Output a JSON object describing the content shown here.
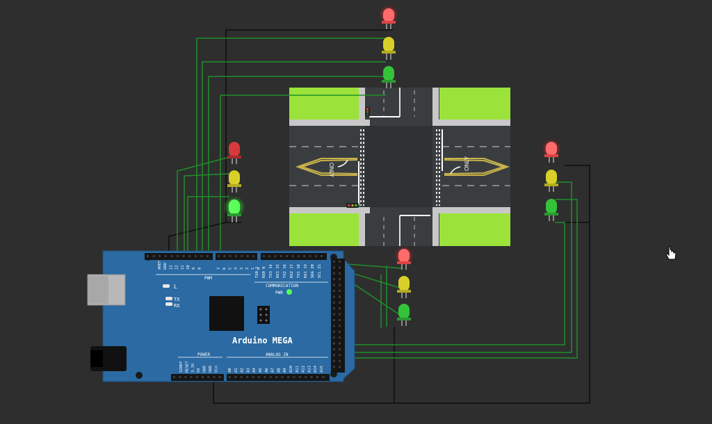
{
  "board": {
    "name": "Arduino MEGA",
    "label_l": "L",
    "label_tx": "TX",
    "label_rx": "RX",
    "label_pwm": "PWM",
    "label_communication": "COMMUNICATION",
    "label_pwr": "PWR",
    "label_power": "POWER",
    "label_analog_in": "ANALOG IN",
    "pwm_pins": [
      "AREF",
      "GND",
      "13",
      "12",
      "11",
      "10",
      "9",
      "8",
      "7",
      "6",
      "5",
      "4",
      "3",
      "2",
      "1",
      "0"
    ],
    "comm_pins": [
      "TX0 1",
      "RX0 0",
      "TX3 14",
      "RX3 15",
      "TX2 16",
      "RX2 17",
      "TX1 18",
      "RX1 19",
      "SDA 20",
      "SCL 21"
    ],
    "power_pins": [
      "IOREF",
      "RESET",
      "3.3V",
      "5V",
      "GND",
      "GND",
      "Vin"
    ],
    "analog_pins": [
      "A0",
      "A1",
      "A2",
      "A3",
      "A4",
      "A5",
      "A6",
      "A7",
      "A8",
      "A9",
      "A10",
      "A11",
      "A12",
      "A13",
      "A14",
      "A15"
    ]
  },
  "road": {
    "marking_text": "ONLY"
  },
  "traffic_lights": [
    {
      "id": "north",
      "states": [
        "red-on",
        "yellow-off",
        "green-off"
      ]
    },
    {
      "id": "west",
      "states": [
        "red-off",
        "yellow-off",
        "green-on"
      ]
    },
    {
      "id": "east",
      "states": [
        "red-on",
        "yellow-off",
        "green-off"
      ]
    },
    {
      "id": "south",
      "states": [
        "red-on",
        "yellow-off",
        "green-off"
      ]
    }
  ],
  "colors": {
    "background": "#2e2e2e",
    "board": "#2b6aa3",
    "grass": "#9be33a",
    "asphalt": "#3a3d40",
    "wire_green": "#1f8f2a",
    "wire_black": "#0d0d0d",
    "led_red": "#e84040",
    "led_yellow": "#d8cf2a",
    "led_green": "#34c23b"
  },
  "cursor": {
    "icon": "hand-pointer-icon"
  }
}
